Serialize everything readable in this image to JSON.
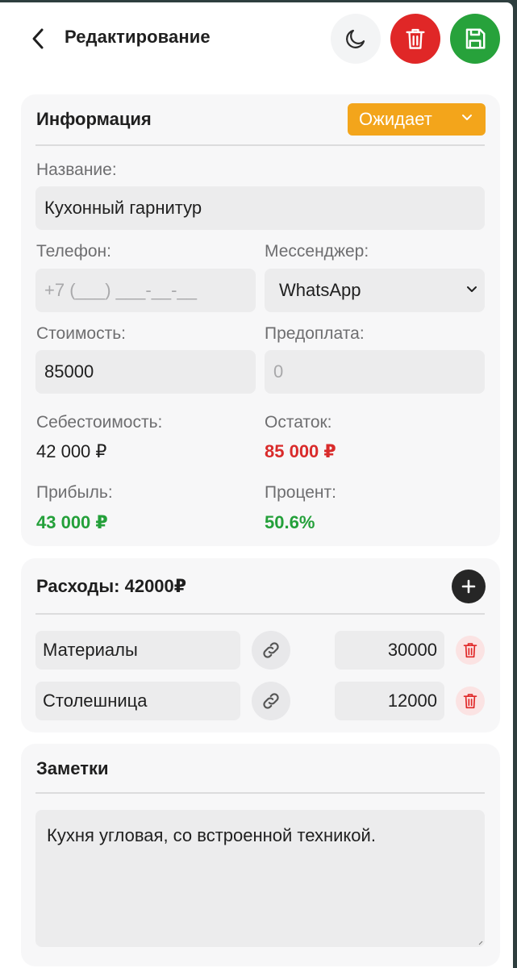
{
  "header": {
    "title": "Редактирование"
  },
  "info": {
    "title": "Информация",
    "status": "Ожидает",
    "name_label": "Название:",
    "name_value": "Кухонный гарнитур",
    "phone_label": "Телефон:",
    "phone_placeholder": "+7 (___) ___-__-__",
    "messenger_label": "Мессенджер:",
    "messenger_value": "WhatsApp",
    "cost_label": "Стоимость:",
    "cost_value": "85000",
    "prepay_label": "Предоплата:",
    "prepay_placeholder": "0",
    "selfcost_label": "Себестоимость:",
    "selfcost_value": "42 000 ₽",
    "remainder_label": "Остаток:",
    "remainder_value": "85 000 ₽",
    "profit_label": "Прибыль:",
    "profit_value": "43 000 ₽",
    "percent_label": "Процент:",
    "percent_value": "50.6%"
  },
  "expenses": {
    "title": "Расходы: 42000₽",
    "items": [
      {
        "name": "Материалы",
        "amount": "30000"
      },
      {
        "name": "Столешница",
        "amount": "12000"
      }
    ]
  },
  "notes": {
    "title": "Заметки",
    "text": "Кухня угловая, со встроенной техникой."
  },
  "colors": {
    "status": "#f3a51b",
    "delete": "#e02727",
    "save": "#27a23b",
    "negative": "#d92b2b",
    "positive": "#24a03a"
  },
  "icons": [
    "chevron-left-icon",
    "moon-icon",
    "trash-icon",
    "floppy-disk-icon",
    "chevron-down-icon",
    "plus-icon",
    "link-icon"
  ]
}
